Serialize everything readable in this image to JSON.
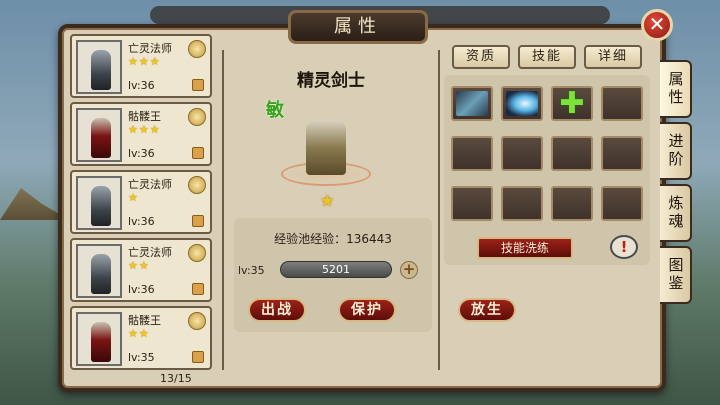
{
  "title": "属性",
  "close_icon": "close-icon",
  "heroes": [
    {
      "name": "亡灵法师",
      "stars": "★★★",
      "level": "lv:36",
      "type": "mage"
    },
    {
      "name": "骷髅王",
      "stars": "★★★",
      "level": "lv:36",
      "type": "skel"
    },
    {
      "name": "亡灵法师",
      "stars": "★",
      "level": "lv:36",
      "type": "mage"
    },
    {
      "name": "亡灵法师",
      "stars": "★★",
      "level": "lv:36",
      "type": "mage"
    },
    {
      "name": "骷髅王",
      "stars": "★★",
      "level": "lv:35",
      "type": "skel"
    }
  ],
  "page_count": "13/15",
  "character": {
    "name": "精灵剑士",
    "attribute": "敏",
    "star": "★",
    "exp_pool": "经验池经验：136443",
    "level": "lv:35",
    "exp_value": "5201",
    "plus": "+"
  },
  "buttons": {
    "battle": "出战",
    "protect": "保护",
    "release": "放生"
  },
  "tabs": [
    "资质",
    "技能",
    "详细"
  ],
  "skills": {
    "reset_label": "技能洗练",
    "info": "!",
    "slot_icons": [
      "axe-skill-icon",
      "slash-skill-icon",
      "add-skill-icon"
    ]
  },
  "side_tabs": [
    "属性",
    "进阶",
    "炼魂",
    "图鉴"
  ],
  "colors": {
    "frame": "#3b2a1e",
    "panel": "#d9cfb6",
    "button_red": "#9b2218",
    "star": "#f2c51e",
    "agility_green": "#3aa220"
  }
}
